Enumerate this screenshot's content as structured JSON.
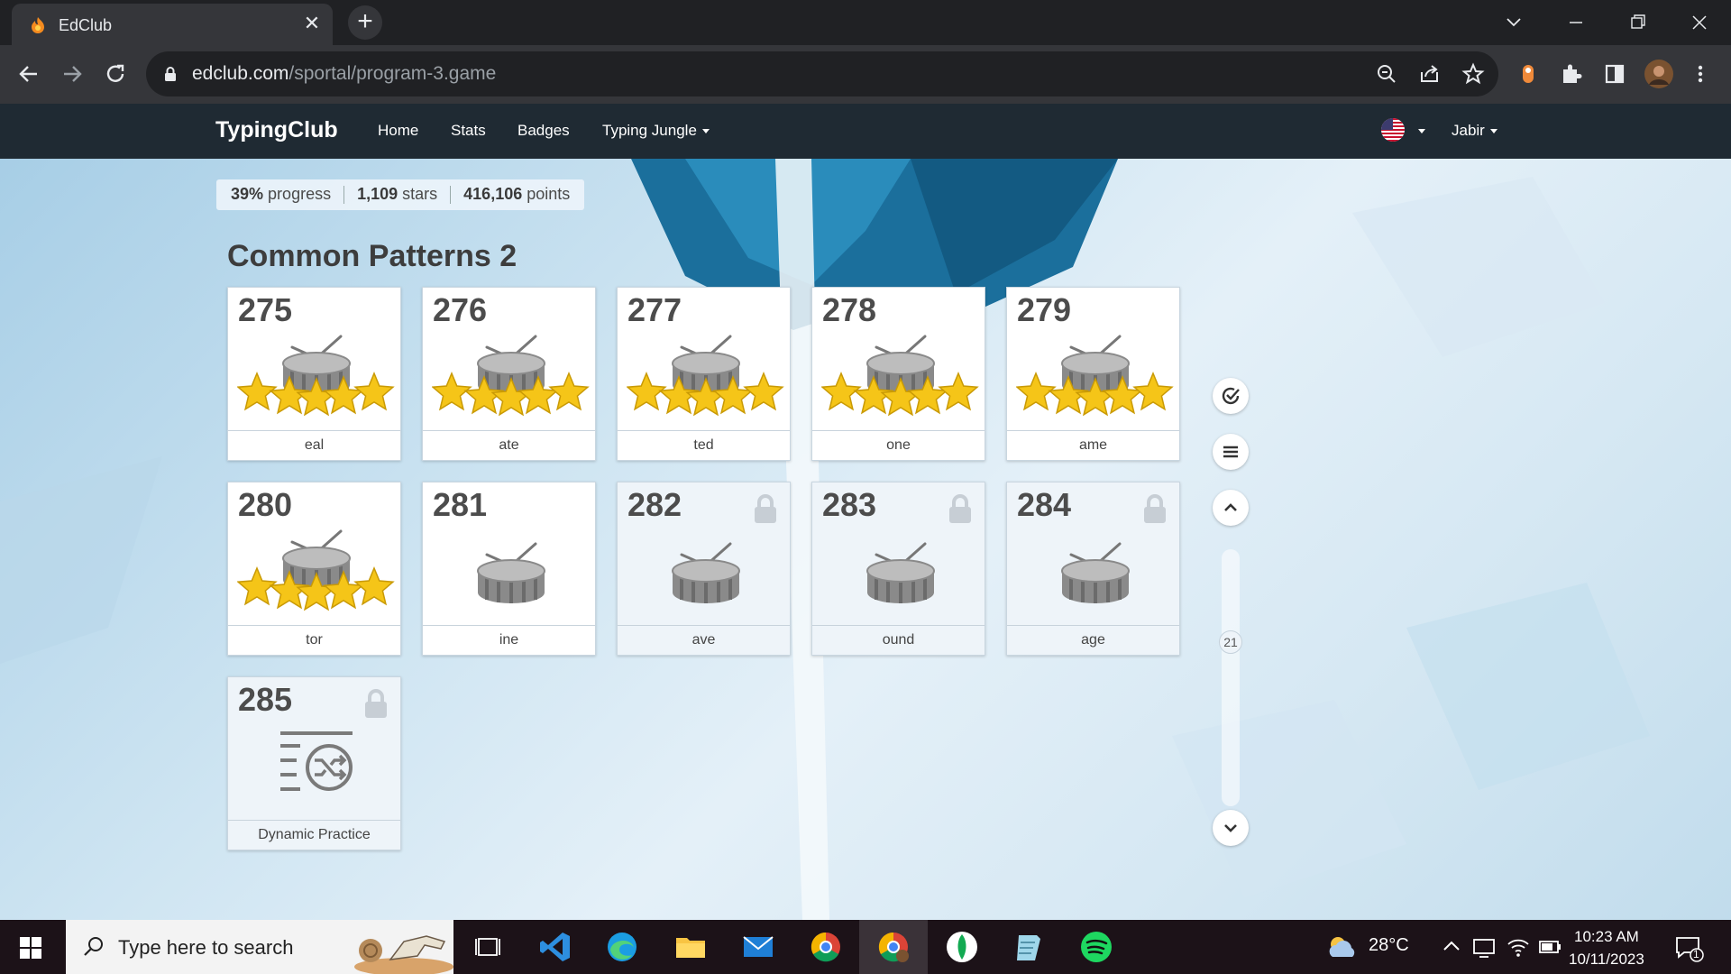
{
  "browser": {
    "tab_title": "EdClub",
    "url_domain": "edclub.com",
    "url_path": "/sportal/program-3.game"
  },
  "site": {
    "brand": "TypingClub",
    "nav": [
      "Home",
      "Stats",
      "Badges",
      "Typing Jungle"
    ],
    "user": "Jabir"
  },
  "stats": {
    "progress_value": "39%",
    "progress_label": "progress",
    "stars_value": "1,109",
    "stars_label": "stars",
    "points_value": "416,106",
    "points_label": "points"
  },
  "section_title": "Common Patterns 2",
  "lessons": [
    {
      "num": "275",
      "label": "eal",
      "stars": 5,
      "locked": false
    },
    {
      "num": "276",
      "label": "ate",
      "stars": 5,
      "locked": false
    },
    {
      "num": "277",
      "label": "ted",
      "stars": 5,
      "locked": false
    },
    {
      "num": "278",
      "label": "one",
      "stars": 5,
      "locked": false
    },
    {
      "num": "279",
      "label": "ame",
      "stars": 5,
      "locked": false
    },
    {
      "num": "280",
      "label": "tor",
      "stars": 5,
      "locked": false
    },
    {
      "num": "281",
      "label": "ine",
      "stars": 0,
      "locked": false
    },
    {
      "num": "282",
      "label": "ave",
      "stars": 0,
      "locked": true
    },
    {
      "num": "283",
      "label": "ound",
      "stars": 0,
      "locked": true
    },
    {
      "num": "284",
      "label": "age",
      "stars": 0,
      "locked": true
    },
    {
      "num": "285",
      "label": "Dynamic Practice",
      "stars": 0,
      "locked": true
    }
  ],
  "scroll_indicator": "21",
  "taskbar": {
    "search_placeholder": "Type here to search",
    "temperature": "28°C",
    "time": "10:23 AM",
    "date": "10/11/2023",
    "notification_count": "1"
  },
  "colors": {
    "site_nav_bg": "#1f2a33",
    "star_gold": "#f5c518",
    "chrome_dark": "#202124"
  }
}
